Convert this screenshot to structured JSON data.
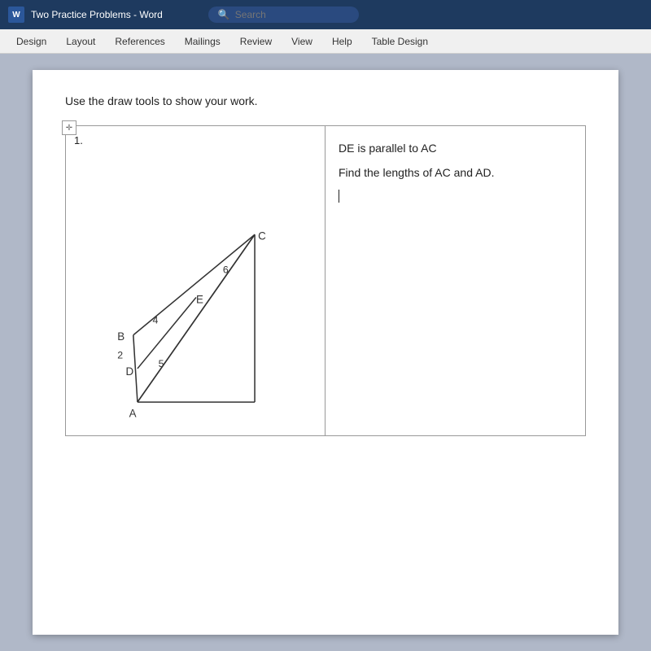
{
  "titlebar": {
    "title": "Two Practice Problems - Word",
    "search_placeholder": "Search"
  },
  "ribbon": {
    "tabs": [
      "Design",
      "Layout",
      "References",
      "Mailings",
      "Review",
      "View",
      "Help",
      "Table Design"
    ]
  },
  "document": {
    "instruction": "Use the draw tools to show your work.",
    "problem_number": "1.",
    "right_cell": {
      "line1": "DE is parallel to AC",
      "line2": "Find the lengths of AC and AD."
    },
    "diagram": {
      "labels": {
        "A": "A",
        "B": "B",
        "C": "C",
        "D": "D",
        "E": "E",
        "num2": "2",
        "num4": "4",
        "num5": "5",
        "num6": "6"
      }
    }
  }
}
